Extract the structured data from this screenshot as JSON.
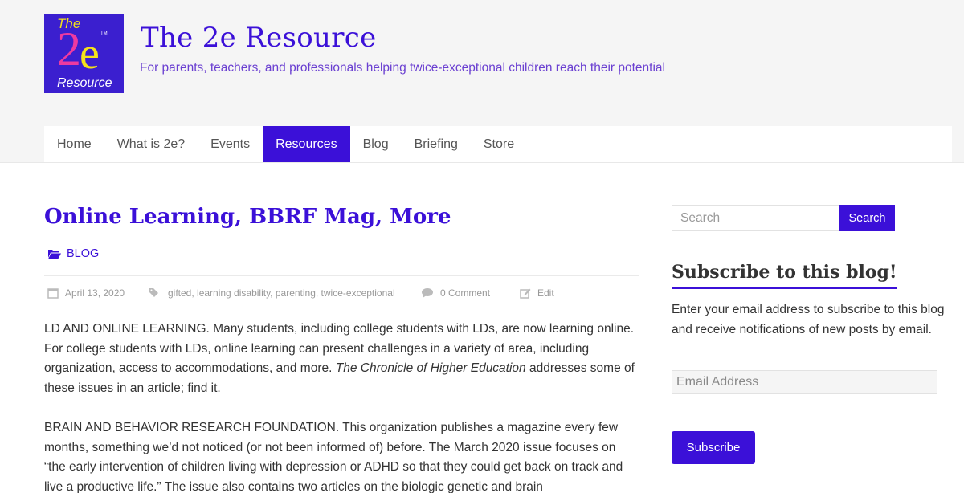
{
  "site": {
    "logo": {
      "the": "The",
      "two": "2",
      "e": "e",
      "tm": "TM",
      "resource": "Resource"
    },
    "title": "The 2e Resource",
    "tagline": "For parents, teachers, and professionals helping twice-exceptional children reach their potential"
  },
  "nav": {
    "items": [
      {
        "label": "Home"
      },
      {
        "label": "What is 2e?"
      },
      {
        "label": "Events"
      },
      {
        "label": "Resources"
      },
      {
        "label": "Blog"
      },
      {
        "label": "Briefing"
      },
      {
        "label": "Store"
      }
    ],
    "active": "Resources"
  },
  "post": {
    "title": "Online Learning, BBRF Mag, More",
    "category": "BLOG",
    "meta": {
      "date": "April 13, 2020",
      "tags": "gifted, learning disability, parenting, twice-exceptional",
      "comments": "0 Comment",
      "edit": "Edit"
    },
    "p1_text": "LD AND ONLINE LEARNING. Many students, including college students with LDs, are now learning online. For college students with LDs, online learning can present challenges in a variety of area, including organization, access to accommodations, and more.",
    "p1_em": "The Chronicle of Higher Education",
    "p1_tail": "addresses some of these issues in an article; find it.",
    "p2": "BRAIN AND BEHAVIOR RESEARCH FOUNDATION. This organization publishes a magazine every few months, something we’d not noticed (or not been informed of) before. The March 2020 issue focuses on “the early intervention of children living with depression or ADHD so that they could get back on track and live a productive life.” The issue also contains two articles on the biologic genetic and brain"
  },
  "sidebar": {
    "search": {
      "placeholder": "Search",
      "button": "Search"
    },
    "subscribe": {
      "title": "Subscribe to this blog!",
      "text": "Enter your email address to subscribe to this blog and receive notifications of new posts by email.",
      "email_placeholder": "Email Address",
      "button": "Subscribe"
    }
  },
  "colors": {
    "accent": "#3b10d8",
    "logo_bg": "#3b1fcf",
    "logo_yellow": "#f5e21a",
    "logo_pink": "#ee3aa0"
  }
}
